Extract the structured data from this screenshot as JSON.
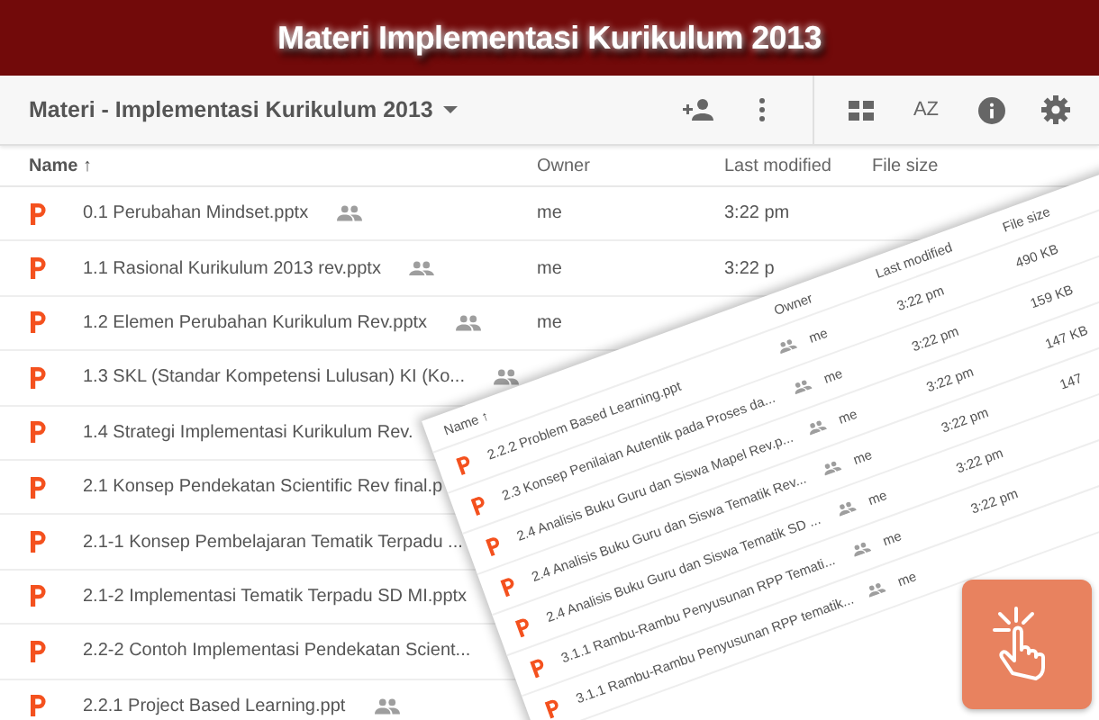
{
  "banner": {
    "title": "Materi Implementasi Kurikulum 2013"
  },
  "toolbar": {
    "folder_title": "Materi - Implementasi Kurikulum 2013",
    "sort_label": "AZ"
  },
  "columns": [
    {
      "label": "Name",
      "sort_arrow": "↑"
    },
    {
      "label": "Owner"
    },
    {
      "label": "Last modified"
    },
    {
      "label": "File size"
    }
  ],
  "files": [
    {
      "name": "0.1 Perubahan Mindset.pptx",
      "shared": true,
      "owner": "me",
      "modified": "3:22 pm"
    },
    {
      "name": "1.1 Rasional Kurikulum 2013 rev.pptx",
      "shared": true,
      "owner": "me",
      "modified": "3:22 p"
    },
    {
      "name": "1.2 Elemen Perubahan Kurikulum Rev.pptx",
      "shared": true,
      "owner": "me"
    },
    {
      "name": "1.3 SKL (Standar Kompetensi Lulusan) KI (Ko...",
      "shared": true
    },
    {
      "name": "1.4 Strategi Implementasi Kurikulum Rev.",
      "shared": false
    },
    {
      "name": "2.1 Konsep Pendekatan Scientific Rev final.p",
      "shared": false
    },
    {
      "name": "2.1-1 Konsep Pembelajaran Tematik Terpadu ...",
      "shared": false
    },
    {
      "name": "2.1-2 Implementasi Tematik Terpadu SD MI.pptx",
      "shared": false
    },
    {
      "name": "2.2-2 Contoh Implementasi Pendekatan Scient...",
      "shared": false
    },
    {
      "name": "2.2.1 Project Based Learning.ppt",
      "shared": true
    }
  ],
  "overlay_sheet": {
    "columns": [
      {
        "label": "Name",
        "sort_arrow": "↑"
      },
      {
        "label": "Owner"
      },
      {
        "label": "Last modified"
      },
      {
        "label": "File size"
      }
    ],
    "files": [
      {
        "name": "2.2.2 Problem Based Learning.ppt",
        "shared": true,
        "owner": "me",
        "modified": "3:22 pm",
        "size": "490 KB"
      },
      {
        "name": "2.3 Konsep Penilaian Autentik pada Proses da...",
        "shared": true,
        "owner": "me",
        "modified": "3:22 pm",
        "size": "159 KB"
      },
      {
        "name": "2.4 Analisis Buku Guru dan Siswa Mapel Rev.p...",
        "shared": true,
        "owner": "me",
        "modified": "3:22 pm",
        "size": "147 KB"
      },
      {
        "name": "2.4 Analisis Buku Guru dan Siswa Tematik Rev...",
        "shared": true,
        "owner": "me",
        "modified": "3:22 pm",
        "size": "147"
      },
      {
        "name": "2.4 Analisis Buku Guru dan Siswa Tematik SD ...",
        "shared": true,
        "owner": "me",
        "modified": "3:22 pm"
      },
      {
        "name": "3.1.1 Rambu-Rambu Penyusunan RPP Temati...",
        "shared": true,
        "owner": "me",
        "modified": "3:22 pm"
      },
      {
        "name": "3.1.1 Rambu-Rambu Penyusunan RPP tematik...",
        "shared": true,
        "owner": "me"
      }
    ]
  }
}
